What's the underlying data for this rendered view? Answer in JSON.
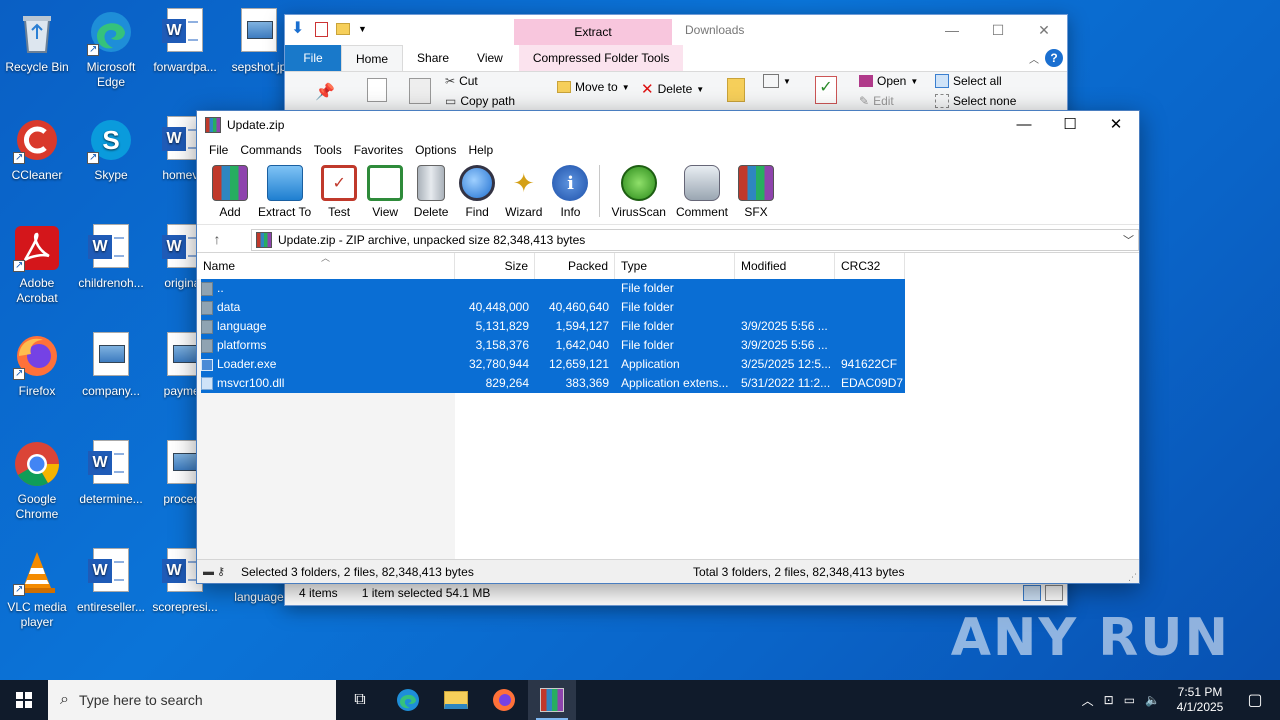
{
  "desktop": {
    "icons": [
      {
        "label": "Recycle Bin"
      },
      {
        "label": "Microsoft Edge"
      },
      {
        "label": "forwardpa..."
      },
      {
        "label": "sepshot.jp"
      },
      {
        "label": "CCleaner"
      },
      {
        "label": "Skype"
      },
      {
        "label": "homevie"
      },
      {
        "label": "Adobe Acrobat"
      },
      {
        "label": "childrenoh..."
      },
      {
        "label": "originall"
      },
      {
        "label": "Firefox"
      },
      {
        "label": "company..."
      },
      {
        "label": "paymen"
      },
      {
        "label": "Google Chrome"
      },
      {
        "label": "determine..."
      },
      {
        "label": "procedu"
      },
      {
        "label": "VLC media player"
      },
      {
        "label": "entireseller..."
      },
      {
        "label": "scorepresi..."
      },
      {
        "label": "language"
      }
    ]
  },
  "explorer": {
    "title": "Downloads",
    "extract_tab": "Extract",
    "tabs": [
      "File",
      "Home",
      "Share",
      "View",
      "Compressed Folder Tools"
    ],
    "ribbon": {
      "cut": "Cut",
      "copy_path": "Copy path",
      "move_to": "Move to",
      "delete": "Delete",
      "open": "Open",
      "edit": "Edit",
      "select_all": "Select all",
      "select_none": "Select none"
    },
    "status": {
      "items": "4 items",
      "selected": "1 item selected  54.1 MB"
    }
  },
  "winrar": {
    "title": "Update.zip",
    "menu": [
      "File",
      "Commands",
      "Tools",
      "Favorites",
      "Options",
      "Help"
    ],
    "toolbar": [
      {
        "label": "Add",
        "icon": "add-archive-icon"
      },
      {
        "label": "Extract To",
        "icon": "extract-folder-icon"
      },
      {
        "label": "Test",
        "icon": "test-clipboard-icon"
      },
      {
        "label": "View",
        "icon": "view-book-icon"
      },
      {
        "label": "Delete",
        "icon": "trash-icon"
      },
      {
        "label": "Find",
        "icon": "magnifier-icon"
      },
      {
        "label": "Wizard",
        "icon": "wand-icon"
      },
      {
        "label": "Info",
        "icon": "info-icon"
      },
      {
        "label": "VirusScan",
        "icon": "virus-scan-icon"
      },
      {
        "label": "Comment",
        "icon": "comment-icon"
      },
      {
        "label": "SFX",
        "icon": "sfx-box-icon"
      }
    ],
    "path": "Update.zip - ZIP archive, unpacked size 82,348,413 bytes",
    "columns": [
      "Name",
      "Size",
      "Packed",
      "Type",
      "Modified",
      "CRC32"
    ],
    "rows": [
      {
        "name": "..",
        "size": "",
        "packed": "",
        "type": "File folder",
        "modified": "",
        "crc": "",
        "kind": "folder"
      },
      {
        "name": "data",
        "size": "40,448,000",
        "packed": "40,460,640",
        "type": "File folder",
        "modified": "",
        "crc": "",
        "kind": "folder"
      },
      {
        "name": "language",
        "size": "5,131,829",
        "packed": "1,594,127",
        "type": "File folder",
        "modified": "3/9/2025 5:56 ...",
        "crc": "",
        "kind": "folder"
      },
      {
        "name": "platforms",
        "size": "3,158,376",
        "packed": "1,642,040",
        "type": "File folder",
        "modified": "3/9/2025 5:56 ...",
        "crc": "",
        "kind": "folder"
      },
      {
        "name": "Loader.exe",
        "size": "32,780,944",
        "packed": "12,659,121",
        "type": "Application",
        "modified": "3/25/2025 12:5...",
        "crc": "941622CF",
        "kind": "app"
      },
      {
        "name": "msvcr100.dll",
        "size": "829,264",
        "packed": "383,369",
        "type": "Application extens...",
        "modified": "5/31/2022 11:2...",
        "crc": "EDAC09D7",
        "kind": "dll"
      }
    ],
    "status_left": "Selected 3 folders, 2 files, 82,348,413 bytes",
    "status_right": "Total 3 folders, 2 files, 82,348,413 bytes"
  },
  "watermark": "ANY RUN",
  "taskbar": {
    "search_placeholder": "Type here to search",
    "time": "7:51 PM",
    "date": "4/1/2025"
  },
  "colors": {
    "selection": "#0a6ed4",
    "desktop": "#0b74d8",
    "taskbar": "#101b2b",
    "extract_tab": "#f8c6dd"
  }
}
